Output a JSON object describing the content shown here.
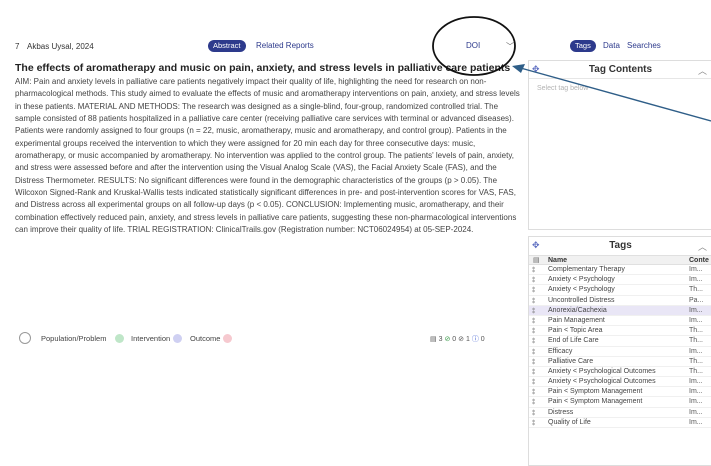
{
  "record": {
    "index": "7",
    "author_year": "Akbas Uysal, 2024",
    "tabs": {
      "abstract": "Abstract",
      "related": "Related Reports"
    },
    "doi_label": "DOI",
    "title": "The effects of aromatherapy and music on pain, anxiety, and stress levels in palliative care patients",
    "abstract": "AIM: Pain and anxiety levels in palliative care patients negatively impact their quality of life, highlighting the need for research on non-pharmacological methods. This study aimed to evaluate the effects of music and aromatherapy interventions on pain, anxiety, and stress levels in these patients. MATERIAL AND METHODS: The research was designed as a single-blind, four-group, randomized controlled trial. The sample consisted of 88 patients hospitalized in a palliative care center (receiving palliative care services with terminal or advanced diseases). Patients were randomly assigned to four groups (n = 22, music, aromatherapy, music and aromatherapy, and control group). Patients in the experimental groups received the intervention to which they were assigned for 20 min each day for three consecutive days: music, aromatherapy, or music accompanied by aromatherapy. No intervention was applied to the control group. The patients' levels of pain, anxiety, and stress were assessed before and after the intervention using the Visual Analog Scale (VAS), the Facial Anxiety Scale (FAS), and the Distress Thermometer. RESULTS: No significant differences were found in the demographic characteristics of the groups (p > 0.05). The Wilcoxon Signed-Rank and Kruskal-Wallis tests indicated statistically significant differences in pre- and post-intervention scores for VAS, FAS, and Distress across all experimental groups on all follow-up days (p < 0.05). CONCLUSION: Implementing music, aromatherapy, and their combination effectively reduced pain, anxiety, and stress levels in palliative care patients, suggesting these non-pharmacological interventions can improve their quality of life. TRIAL REGISTRATION: ClinicalTrails.gov (Registration number: NCT06024954) at 05-SEP-2024.",
    "pico": {
      "population": "Population/Problem",
      "intervention": "Intervention",
      "outcome": "Outcome",
      "colors": {
        "population": "#bfe6c8",
        "intervention": "#cfd0f2",
        "outcome": "#f6c9cf"
      }
    },
    "counts": {
      "total": "3",
      "green": "0",
      "grey": "0",
      "one": "1",
      "blue": "0"
    }
  },
  "right": {
    "tabs": {
      "tags": "Tags",
      "data": "Data",
      "searches": "Searches"
    },
    "tag_contents": {
      "title": "Tag Contents",
      "placeholder": "Select tag below"
    },
    "tags_panel": {
      "title": "Tags",
      "col_name": "Name",
      "col_content": "Conte",
      "rows": [
        {
          "name": "Complementary Therapy",
          "content": "Im..."
        },
        {
          "name": "Anxiety < Psychology",
          "content": "Im..."
        },
        {
          "name": "Anxiety < Psychology",
          "content": "Th..."
        },
        {
          "name": "Uncontrolled Distress",
          "content": "Pa..."
        },
        {
          "name": "Anorexia/Cachexia",
          "content": "Im..."
        },
        {
          "name": "Pain Management",
          "content": "Im..."
        },
        {
          "name": "Pain < Topic Area",
          "content": "Th..."
        },
        {
          "name": "End of Life Care",
          "content": "Th..."
        },
        {
          "name": "Efficacy",
          "content": "Im..."
        },
        {
          "name": "Palliative Care",
          "content": "Th..."
        },
        {
          "name": "Anxiety < Psychological Outcomes",
          "content": "Th..."
        },
        {
          "name": "Anxiety < Psychological Outcomes",
          "content": "Im..."
        },
        {
          "name": "Pain < Symptom Management",
          "content": "Im..."
        },
        {
          "name": "Pain < Symptom Management",
          "content": "Im..."
        },
        {
          "name": "Distress",
          "content": "Im..."
        },
        {
          "name": "Quality of Life",
          "content": "Im..."
        }
      ]
    }
  },
  "accent": "#2d3a8c",
  "selected_row_color": "#e9e6f6"
}
